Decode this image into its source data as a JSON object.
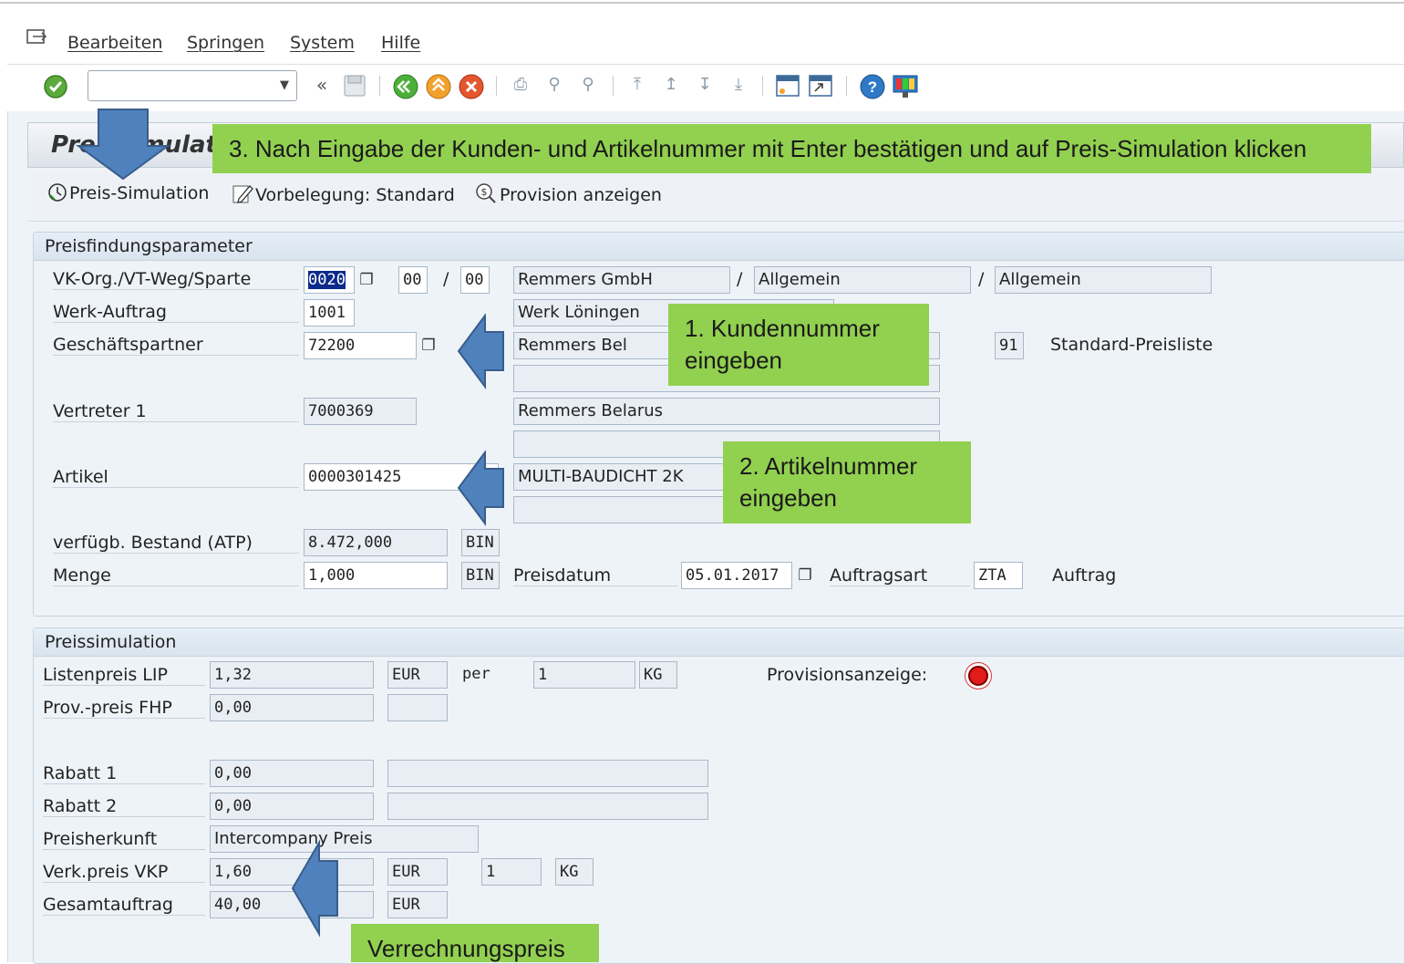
{
  "menu": {
    "items": [
      "Bearbeiten",
      "Springen",
      "System",
      "Hilfe"
    ]
  },
  "toolbar": {
    "command_field_value": "",
    "icons": [
      "check-icon",
      "back-double-icon",
      "save-icon",
      "back-icon",
      "exit-icon",
      "cancel-icon",
      "print-icon",
      "find-icon",
      "find-next-icon",
      "first-page-icon",
      "prev-page-icon",
      "next-page-icon",
      "last-page-icon",
      "new-session-icon",
      "shortcut-icon",
      "help-icon",
      "customize-icon"
    ]
  },
  "app": {
    "title": "Preissimulation",
    "buttons": {
      "preis_simulation": "Preis-Simulation",
      "vorbelegung": "Vorbelegung: Standard",
      "provision": "Provision anzeigen"
    }
  },
  "preisfindung": {
    "title": "Preisfindungsparameter",
    "vkorg_label": "VK-Org./VT-Weg/Sparte",
    "vkorg": "0020",
    "vtweg": "00",
    "sparte": "00",
    "slash": "/",
    "vkorg_text": "Remmers GmbH",
    "vtweg_text": "Allgemein",
    "sparte_text": "Allgemein",
    "werk_label": "Werk-Auftrag",
    "werk": "1001",
    "werk_text": "Werk Löningen",
    "gp_label": "Geschäftspartner",
    "gp": "72200",
    "gp_text": "Remmers Bel",
    "pricelist_no": "91",
    "pricelist_text": "Standard-Preisliste",
    "vertreter_label": "Vertreter 1",
    "vertreter": "7000369",
    "vertreter_text": "Remmers Belarus",
    "artikel_label": "Artikel",
    "artikel": "0000301425",
    "artikel_text": "MULTI-BAUDICHT 2K",
    "atp_label": "verfügb. Bestand (ATP)",
    "atp": "8.472,000",
    "atp_unit": "BIN",
    "menge_label": "Menge",
    "menge": "1,000",
    "menge_unit": "BIN",
    "preisdatum_label": "Preisdatum",
    "preisdatum": "05.01.2017",
    "auftragsart_label": "Auftragsart",
    "auftragsart": "ZTA",
    "auftragsart_text": "Auftrag"
  },
  "preissimulation": {
    "title": "Preissimulation",
    "lip_label": "Listenpreis LIP",
    "lip": "1,32",
    "lip_cur": "EUR",
    "per_label": "per",
    "per_qty": "1",
    "per_unit": "KG",
    "provisionsanzeige_label": "Provisionsanzeige:",
    "fhp_label": "Prov.-preis FHP",
    "fhp": "0,00",
    "rabatt1_label": "Rabatt 1",
    "rabatt1": "0,00",
    "rabatt2_label": "Rabatt 2",
    "rabatt2": "0,00",
    "herkunft_label": "Preisherkunft",
    "herkunft": "Intercompany Preis",
    "vkp_label": "Verk.preis VKP",
    "vkp": "1,60",
    "vkp_cur": "EUR",
    "vkp_qty": "1",
    "vkp_unit": "KG",
    "gesamt_label": "Gesamtauftrag",
    "gesamt": "40,00",
    "gesamt_cur": "EUR"
  },
  "callouts": {
    "step3": "3. Nach Eingabe der Kunden- und Artikelnummer mit Enter bestätigen und auf Preis-Simulation klicken",
    "step1": "1. Kundennummer eingeben",
    "step2": "2. Artikelnummer eingeben",
    "verrechnung": "Verrechnungspreis"
  },
  "colors": {
    "callout_green": "#92d050",
    "arrow_blue": "#4f81bd",
    "led_red": "#e21b1b"
  }
}
